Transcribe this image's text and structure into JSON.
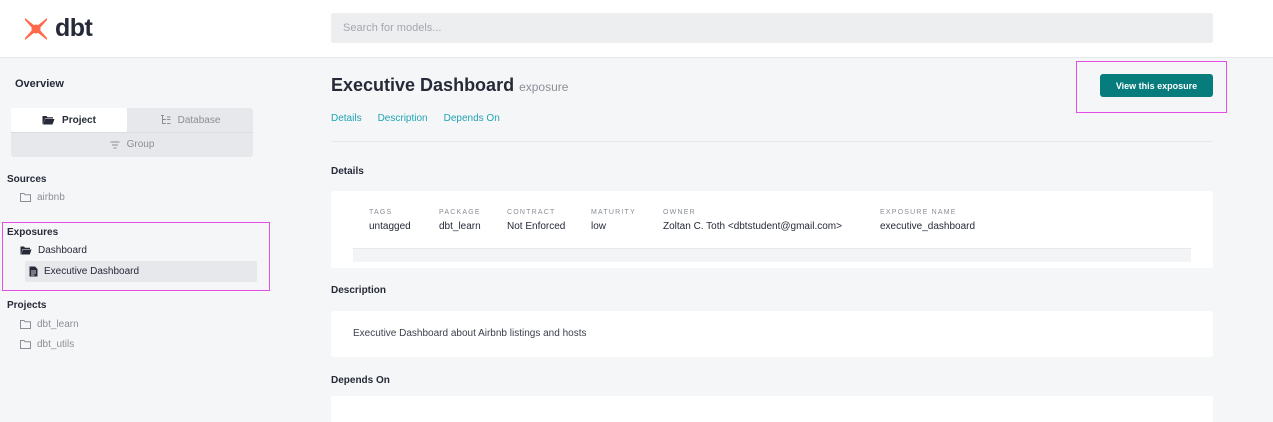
{
  "header": {
    "logo_text": "dbt",
    "search_placeholder": "Search for models..."
  },
  "sidebar": {
    "overview_label": "Overview",
    "tabs": {
      "project": "Project",
      "database": "Database",
      "group": "Group"
    },
    "sources": {
      "title": "Sources",
      "items": [
        "airbnb"
      ]
    },
    "exposures": {
      "title": "Exposures",
      "folder": "Dashboard",
      "selected_item": "Executive Dashboard"
    },
    "projects": {
      "title": "Projects",
      "items": [
        "dbt_learn",
        "dbt_utils"
      ]
    }
  },
  "main": {
    "title": "Executive Dashboard",
    "subtitle": "exposure",
    "view_button": "View this exposure",
    "nav": [
      "Details",
      "Description",
      "Depends On"
    ],
    "details_title": "Details",
    "details": [
      {
        "label": "TAGS",
        "value": "untagged"
      },
      {
        "label": "PACKAGE",
        "value": "dbt_learn"
      },
      {
        "label": "CONTRACT",
        "value": "Not Enforced"
      },
      {
        "label": "MATURITY",
        "value": "low"
      },
      {
        "label": "OWNER",
        "value": "Zoltan C. Toth <dbtstudent@gmail.com>"
      },
      {
        "label": "EXPOSURE NAME",
        "value": "executive_dashboard"
      }
    ],
    "description_title": "Description",
    "description_text": "Executive Dashboard about Airbnb listings and hosts",
    "depends_on_title": "Depends On"
  },
  "colors": {
    "accent": "#20a4b4",
    "button": "#077c7c",
    "brand": "#ff694a",
    "highlight": "#e64ce6"
  }
}
